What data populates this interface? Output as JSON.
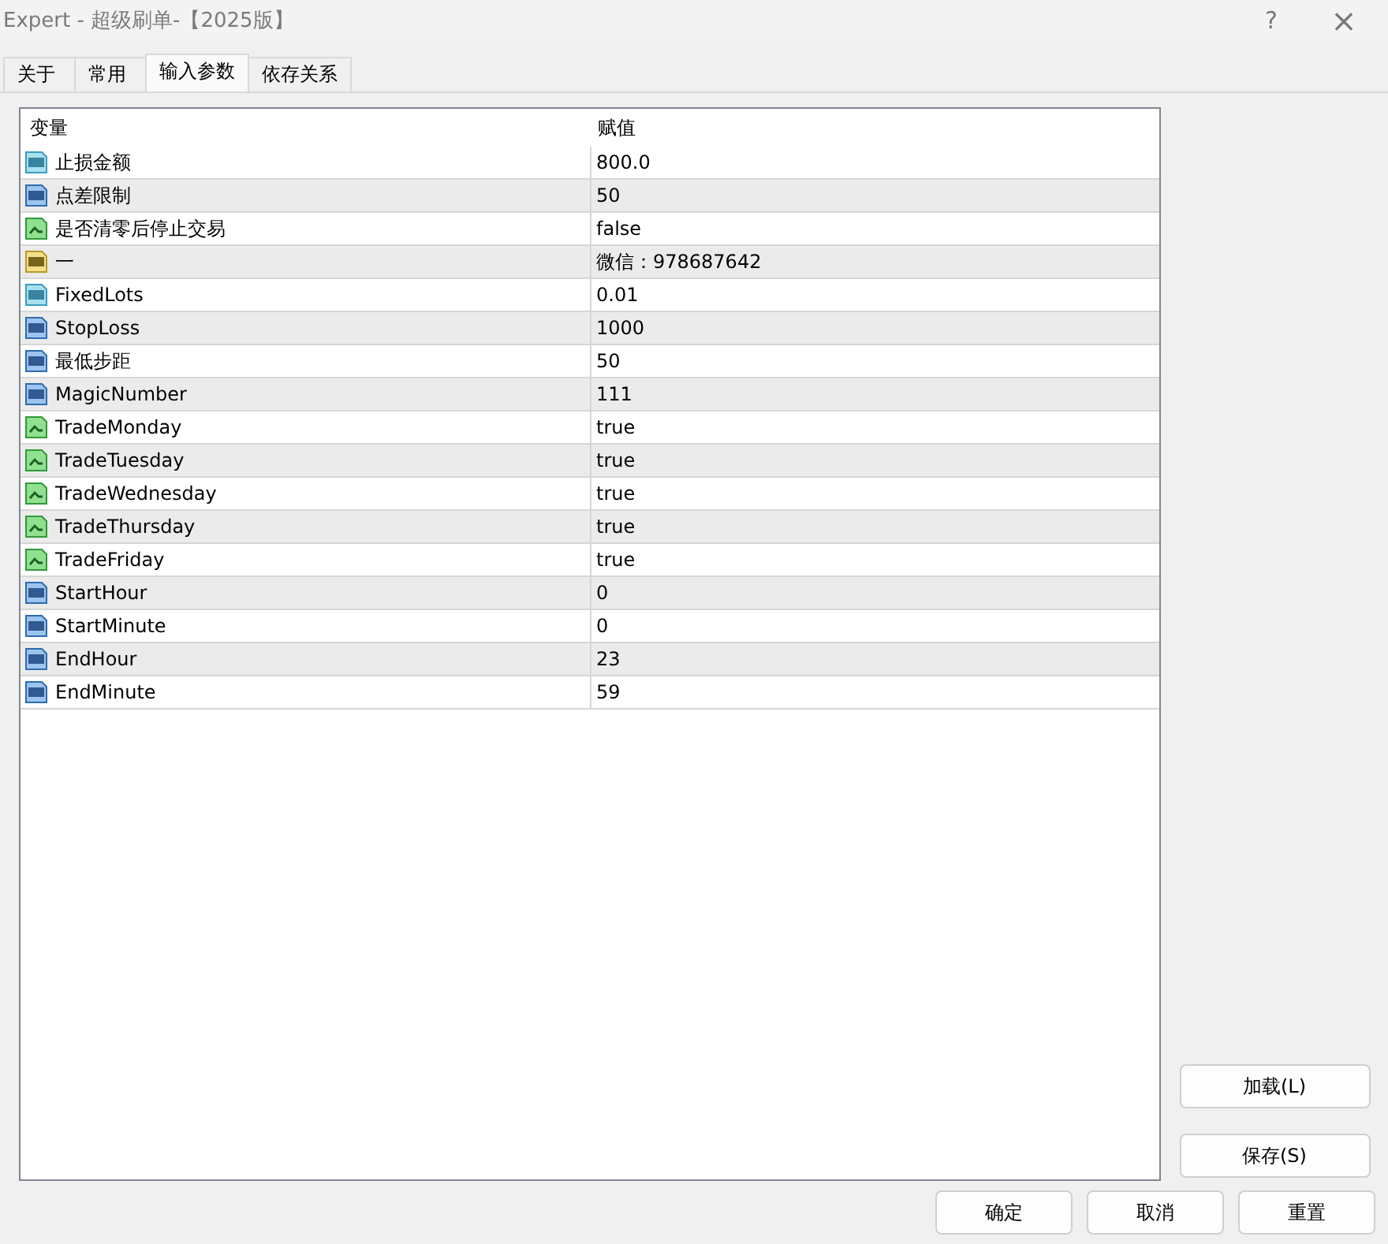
{
  "window": {
    "title": "Expert - 超级刷单-【2025版】",
    "help": "?",
    "close": "×"
  },
  "tabs": [
    {
      "label": "关于",
      "selected": false
    },
    {
      "label": "常用",
      "selected": false
    },
    {
      "label": "输入参数",
      "selected": true
    },
    {
      "label": "依存关系",
      "selected": false
    }
  ],
  "table": {
    "columns": [
      "变量",
      "赋值"
    ],
    "rows": [
      {
        "kind": "double",
        "name": "止损金额",
        "value": "800.0"
      },
      {
        "kind": "int",
        "name": "点差限制",
        "value": "50"
      },
      {
        "kind": "bool",
        "name": "是否清零后停止交易",
        "value": "false"
      },
      {
        "kind": "string",
        "name": "一",
        "value": "微信：978687642"
      },
      {
        "kind": "double",
        "name": "FixedLots",
        "value": "0.01"
      },
      {
        "kind": "int",
        "name": "StopLoss",
        "value": "1000"
      },
      {
        "kind": "int",
        "name": "最低步距",
        "value": "50"
      },
      {
        "kind": "int",
        "name": "MagicNumber",
        "value": "111"
      },
      {
        "kind": "bool",
        "name": "TradeMonday",
        "value": "true"
      },
      {
        "kind": "bool",
        "name": "TradeTuesday",
        "value": "true"
      },
      {
        "kind": "bool",
        "name": "TradeWednesday",
        "value": "true"
      },
      {
        "kind": "bool",
        "name": "TradeThursday",
        "value": "true"
      },
      {
        "kind": "bool",
        "name": "TradeFriday",
        "value": "true"
      },
      {
        "kind": "int",
        "name": "StartHour",
        "value": "0"
      },
      {
        "kind": "int",
        "name": "StartMinute",
        "value": "0"
      },
      {
        "kind": "int",
        "name": "EndHour",
        "value": "23"
      },
      {
        "kind": "int",
        "name": "EndMinute",
        "value": "59"
      }
    ]
  },
  "side_buttons": [
    "加载(L)",
    "保存(S)"
  ],
  "buttons": [
    "确定",
    "取消",
    "重置"
  ]
}
